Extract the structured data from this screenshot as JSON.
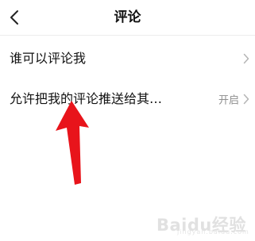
{
  "header": {
    "title": "评论",
    "back_icon": "chevron-left-icon"
  },
  "settings": [
    {
      "label": "谁可以评论我",
      "value": "",
      "icon": "chevron-right-icon"
    },
    {
      "label": "允许把我的评论推送给其…",
      "value": "开启",
      "icon": "chevron-right-icon"
    }
  ],
  "annotation": {
    "icon": "red-pointer-arrow-icon",
    "color": "#e8141b"
  },
  "watermark": {
    "text": "Baidu经验",
    "sub": "jingyan.baidu.com"
  }
}
